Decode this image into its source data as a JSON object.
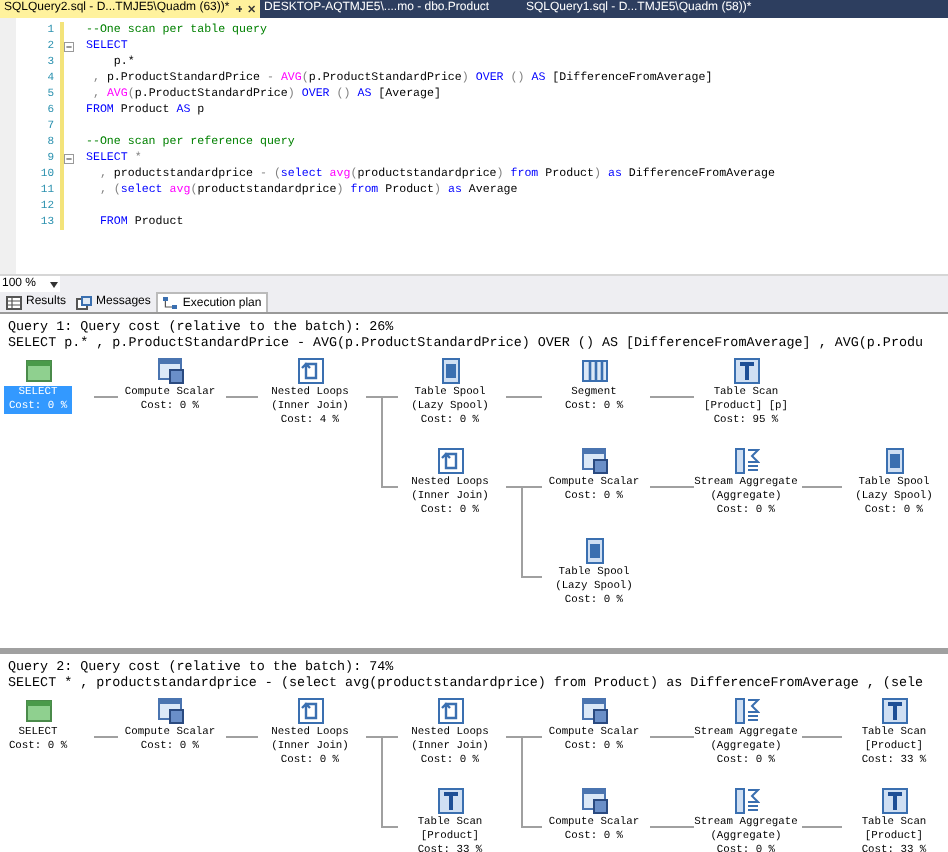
{
  "doc_tabs": [
    {
      "label": "SQLQuery2.sql - D...TMJE5\\Quadm (63))*",
      "selected": true
    },
    {
      "label": "DESKTOP-AQTMJE5\\....mo - dbo.Product",
      "selected": false
    },
    {
      "label": "SQLQuery1.sql - D...TMJE5\\Quadm (58))*",
      "selected": false
    }
  ],
  "editor": {
    "lines": [
      {
        "number": "1",
        "collapsible": false,
        "tokens": [
          {
            "text": "--One scan per table query",
            "kind": "comment"
          }
        ]
      },
      {
        "number": "2",
        "collapsible": true,
        "tokens": [
          {
            "text": "SELECT",
            "kind": "keyword"
          }
        ]
      },
      {
        "number": "3",
        "collapsible": false,
        "tokens": [
          {
            "text": "    p.*",
            "kind": "plain"
          }
        ]
      },
      {
        "number": "4",
        "collapsible": false,
        "tokens": [
          {
            "text": " ,",
            "kind": "operator"
          },
          {
            "text": " p.ProductStandardPrice ",
            "kind": "plain"
          },
          {
            "text": "- ",
            "kind": "operator"
          },
          {
            "text": "AVG",
            "kind": "function"
          },
          {
            "text": "(",
            "kind": "operator"
          },
          {
            "text": "p.ProductStandardPrice",
            "kind": "plain"
          },
          {
            "text": ") ",
            "kind": "operator"
          },
          {
            "text": "OVER",
            "kind": "keyword"
          },
          {
            "text": " () ",
            "kind": "operator"
          },
          {
            "text": "AS",
            "kind": "keyword"
          },
          {
            "text": " [DifferenceFromAverage]",
            "kind": "plain"
          }
        ]
      },
      {
        "number": "5",
        "collapsible": false,
        "tokens": [
          {
            "text": " , ",
            "kind": "operator"
          },
          {
            "text": "AVG",
            "kind": "function"
          },
          {
            "text": "(",
            "kind": "operator"
          },
          {
            "text": "p.ProductStandardPrice",
            "kind": "plain"
          },
          {
            "text": ") ",
            "kind": "operator"
          },
          {
            "text": "OVER",
            "kind": "keyword"
          },
          {
            "text": " () ",
            "kind": "operator"
          },
          {
            "text": "AS",
            "kind": "keyword"
          },
          {
            "text": " [Average]",
            "kind": "plain"
          }
        ]
      },
      {
        "number": "6",
        "collapsible": false,
        "tokens": [
          {
            "text": "FROM",
            "kind": "keyword"
          },
          {
            "text": " Product ",
            "kind": "plain"
          },
          {
            "text": "AS",
            "kind": "keyword"
          },
          {
            "text": " p",
            "kind": "plain"
          }
        ]
      },
      {
        "number": "7",
        "collapsible": false
      },
      {
        "number": "8",
        "collapsible": false,
        "tokens": [
          {
            "text": "--One scan per reference query",
            "kind": "comment"
          }
        ]
      },
      {
        "number": "9",
        "collapsible": true,
        "tokens": [
          {
            "text": "SELECT",
            "kind": "keyword"
          },
          {
            "text": " *",
            "kind": "operator"
          }
        ]
      },
      {
        "number": "10",
        "collapsible": false,
        "tokens": [
          {
            "text": "  ,",
            "kind": "operator"
          },
          {
            "text": " productstandardprice ",
            "kind": "plain"
          },
          {
            "text": "- (",
            "kind": "operator"
          },
          {
            "text": "select ",
            "kind": "keyword"
          },
          {
            "text": "avg",
            "kind": "function"
          },
          {
            "text": "(",
            "kind": "operator"
          },
          {
            "text": "productstandardprice",
            "kind": "plain"
          },
          {
            "text": ") ",
            "kind": "operator"
          },
          {
            "text": "from",
            "kind": "keyword"
          },
          {
            "text": " Product",
            "kind": "plain"
          },
          {
            "text": ") ",
            "kind": "operator"
          },
          {
            "text": "as",
            "kind": "keyword"
          },
          {
            "text": " DifferenceFromAverage",
            "kind": "plain"
          }
        ]
      },
      {
        "number": "11",
        "collapsible": false,
        "tokens": [
          {
            "text": "  , (",
            "kind": "operator"
          },
          {
            "text": "select ",
            "kind": "keyword"
          },
          {
            "text": "avg",
            "kind": "function"
          },
          {
            "text": "(",
            "kind": "operator"
          },
          {
            "text": "productstandardprice",
            "kind": "plain"
          },
          {
            "text": ") ",
            "kind": "operator"
          },
          {
            "text": "from",
            "kind": "keyword"
          },
          {
            "text": " Product",
            "kind": "plain"
          },
          {
            "text": ") ",
            "kind": "operator"
          },
          {
            "text": "as",
            "kind": "keyword"
          },
          {
            "text": " Average",
            "kind": "plain"
          }
        ]
      },
      {
        "number": "12",
        "collapsible": false
      },
      {
        "number": "13",
        "collapsible": false,
        "tokens": [
          {
            "text": "  FROM",
            "kind": "keyword"
          },
          {
            "text": " Product",
            "kind": "plain"
          }
        ]
      }
    ]
  },
  "zoom": {
    "value": "100 %"
  },
  "result_tabs": [
    {
      "label": "Results",
      "selected": false
    },
    {
      "label": "Messages",
      "selected": false
    },
    {
      "label": "Execution plan",
      "selected": true
    }
  ],
  "plans": [
    {
      "title": "Query 1: Query cost (relative to the batch): 26%",
      "sql": "SELECT p.* , p.ProductStandardPrice - AVG(p.ProductStandardPrice) OVER () AS [DifferenceFromAverage] , AVG(p.Produ",
      "root": {
        "kind": "select",
        "lines": [
          "SELECT",
          "Cost: 0 %"
        ],
        "selected": true,
        "children": [
          {
            "kind": "compute",
            "lines": [
              "Compute Scalar",
              "Cost: 0 %"
            ],
            "selected": false,
            "children": [
              {
                "kind": "loops",
                "lines": [
                  "Nested Loops",
                  "(Inner Join)",
                  "Cost: 4 %"
                ],
                "selected": false,
                "children": [
                  {
                    "kind": "spool",
                    "lines": [
                      "Table Spool",
                      "(Lazy Spool)",
                      "Cost: 0 %"
                    ],
                    "selected": false,
                    "children": [
                      {
                        "kind": "segment",
                        "lines": [
                          "Segment",
                          "Cost: 0 %"
                        ],
                        "selected": false,
                        "children": [
                          {
                            "kind": "scan",
                            "lines": [
                              "Table Scan",
                              "[Product] [p]",
                              "Cost: 95 %"
                            ],
                            "selected": false
                          }
                        ]
                      }
                    ]
                  },
                  {
                    "kind": "loops",
                    "lines": [
                      "Nested Loops",
                      "(Inner Join)",
                      "Cost: 0 %"
                    ],
                    "selected": false,
                    "children": [
                      {
                        "kind": "compute",
                        "lines": [
                          "Compute Scalar",
                          "Cost: 0 %"
                        ],
                        "selected": false,
                        "children": [
                          {
                            "kind": "aggregate",
                            "lines": [
                              "Stream Aggregate",
                              "(Aggregate)",
                              "Cost: 0 %"
                            ],
                            "selected": false,
                            "children": [
                              {
                                "kind": "spool",
                                "lines": [
                                  "Table Spool",
                                  "(Lazy Spool)",
                                  "Cost: 0 %"
                                ],
                                "selected": false
                              }
                            ]
                          }
                        ]
                      },
                      {
                        "kind": "spool",
                        "lines": [
                          "Table Spool",
                          "(Lazy Spool)",
                          "Cost: 0 %"
                        ],
                        "selected": false
                      }
                    ]
                  }
                ]
              }
            ]
          }
        ]
      }
    },
    {
      "title": "Query 2: Query cost (relative to the batch): 74%",
      "sql": "SELECT * , productstandardprice - (select avg(productstandardprice) from Product) as DifferenceFromAverage , (sele",
      "root": {
        "kind": "select",
        "lines": [
          "SELECT",
          "Cost: 0 %"
        ],
        "selected": false,
        "children": [
          {
            "kind": "compute",
            "lines": [
              "Compute Scalar",
              "Cost: 0 %"
            ],
            "selected": false,
            "children": [
              {
                "kind": "loops",
                "lines": [
                  "Nested Loops",
                  "(Inner Join)",
                  "Cost: 0 %"
                ],
                "selected": false,
                "children": [
                  {
                    "kind": "loops",
                    "lines": [
                      "Nested Loops",
                      "(Inner Join)",
                      "Cost: 0 %"
                    ],
                    "selected": false,
                    "children": [
                      {
                        "kind": "compute",
                        "lines": [
                          "Compute Scalar",
                          "Cost: 0 %"
                        ],
                        "selected": false,
                        "children": [
                          {
                            "kind": "aggregate",
                            "lines": [
                              "Stream Aggregate",
                              "(Aggregate)",
                              "Cost: 0 %"
                            ],
                            "selected": false,
                            "children": [
                              {
                                "kind": "scan",
                                "lines": [
                                  "Table Scan",
                                  "[Product]",
                                  "Cost: 33 %"
                                ],
                                "selected": false
                              }
                            ]
                          }
                        ]
                      },
                      {
                        "kind": "compute",
                        "lines": [
                          "Compute Scalar",
                          "Cost: 0 %"
                        ],
                        "selected": false,
                        "children": [
                          {
                            "kind": "aggregate",
                            "lines": [
                              "Stream Aggregate",
                              "(Aggregate)",
                              "Cost: 0 %"
                            ],
                            "selected": false,
                            "children": [
                              {
                                "kind": "scan",
                                "lines": [
                                  "Table Scan",
                                  "[Product]",
                                  "Cost: 33 %"
                                ],
                                "selected": false
                              }
                            ]
                          }
                        ]
                      }
                    ]
                  },
                  {
                    "kind": "scan",
                    "lines": [
                      "Table Scan",
                      "[Product]",
                      "Cost: 33 %"
                    ],
                    "selected": false
                  }
                ]
              }
            ]
          }
        ]
      }
    }
  ]
}
